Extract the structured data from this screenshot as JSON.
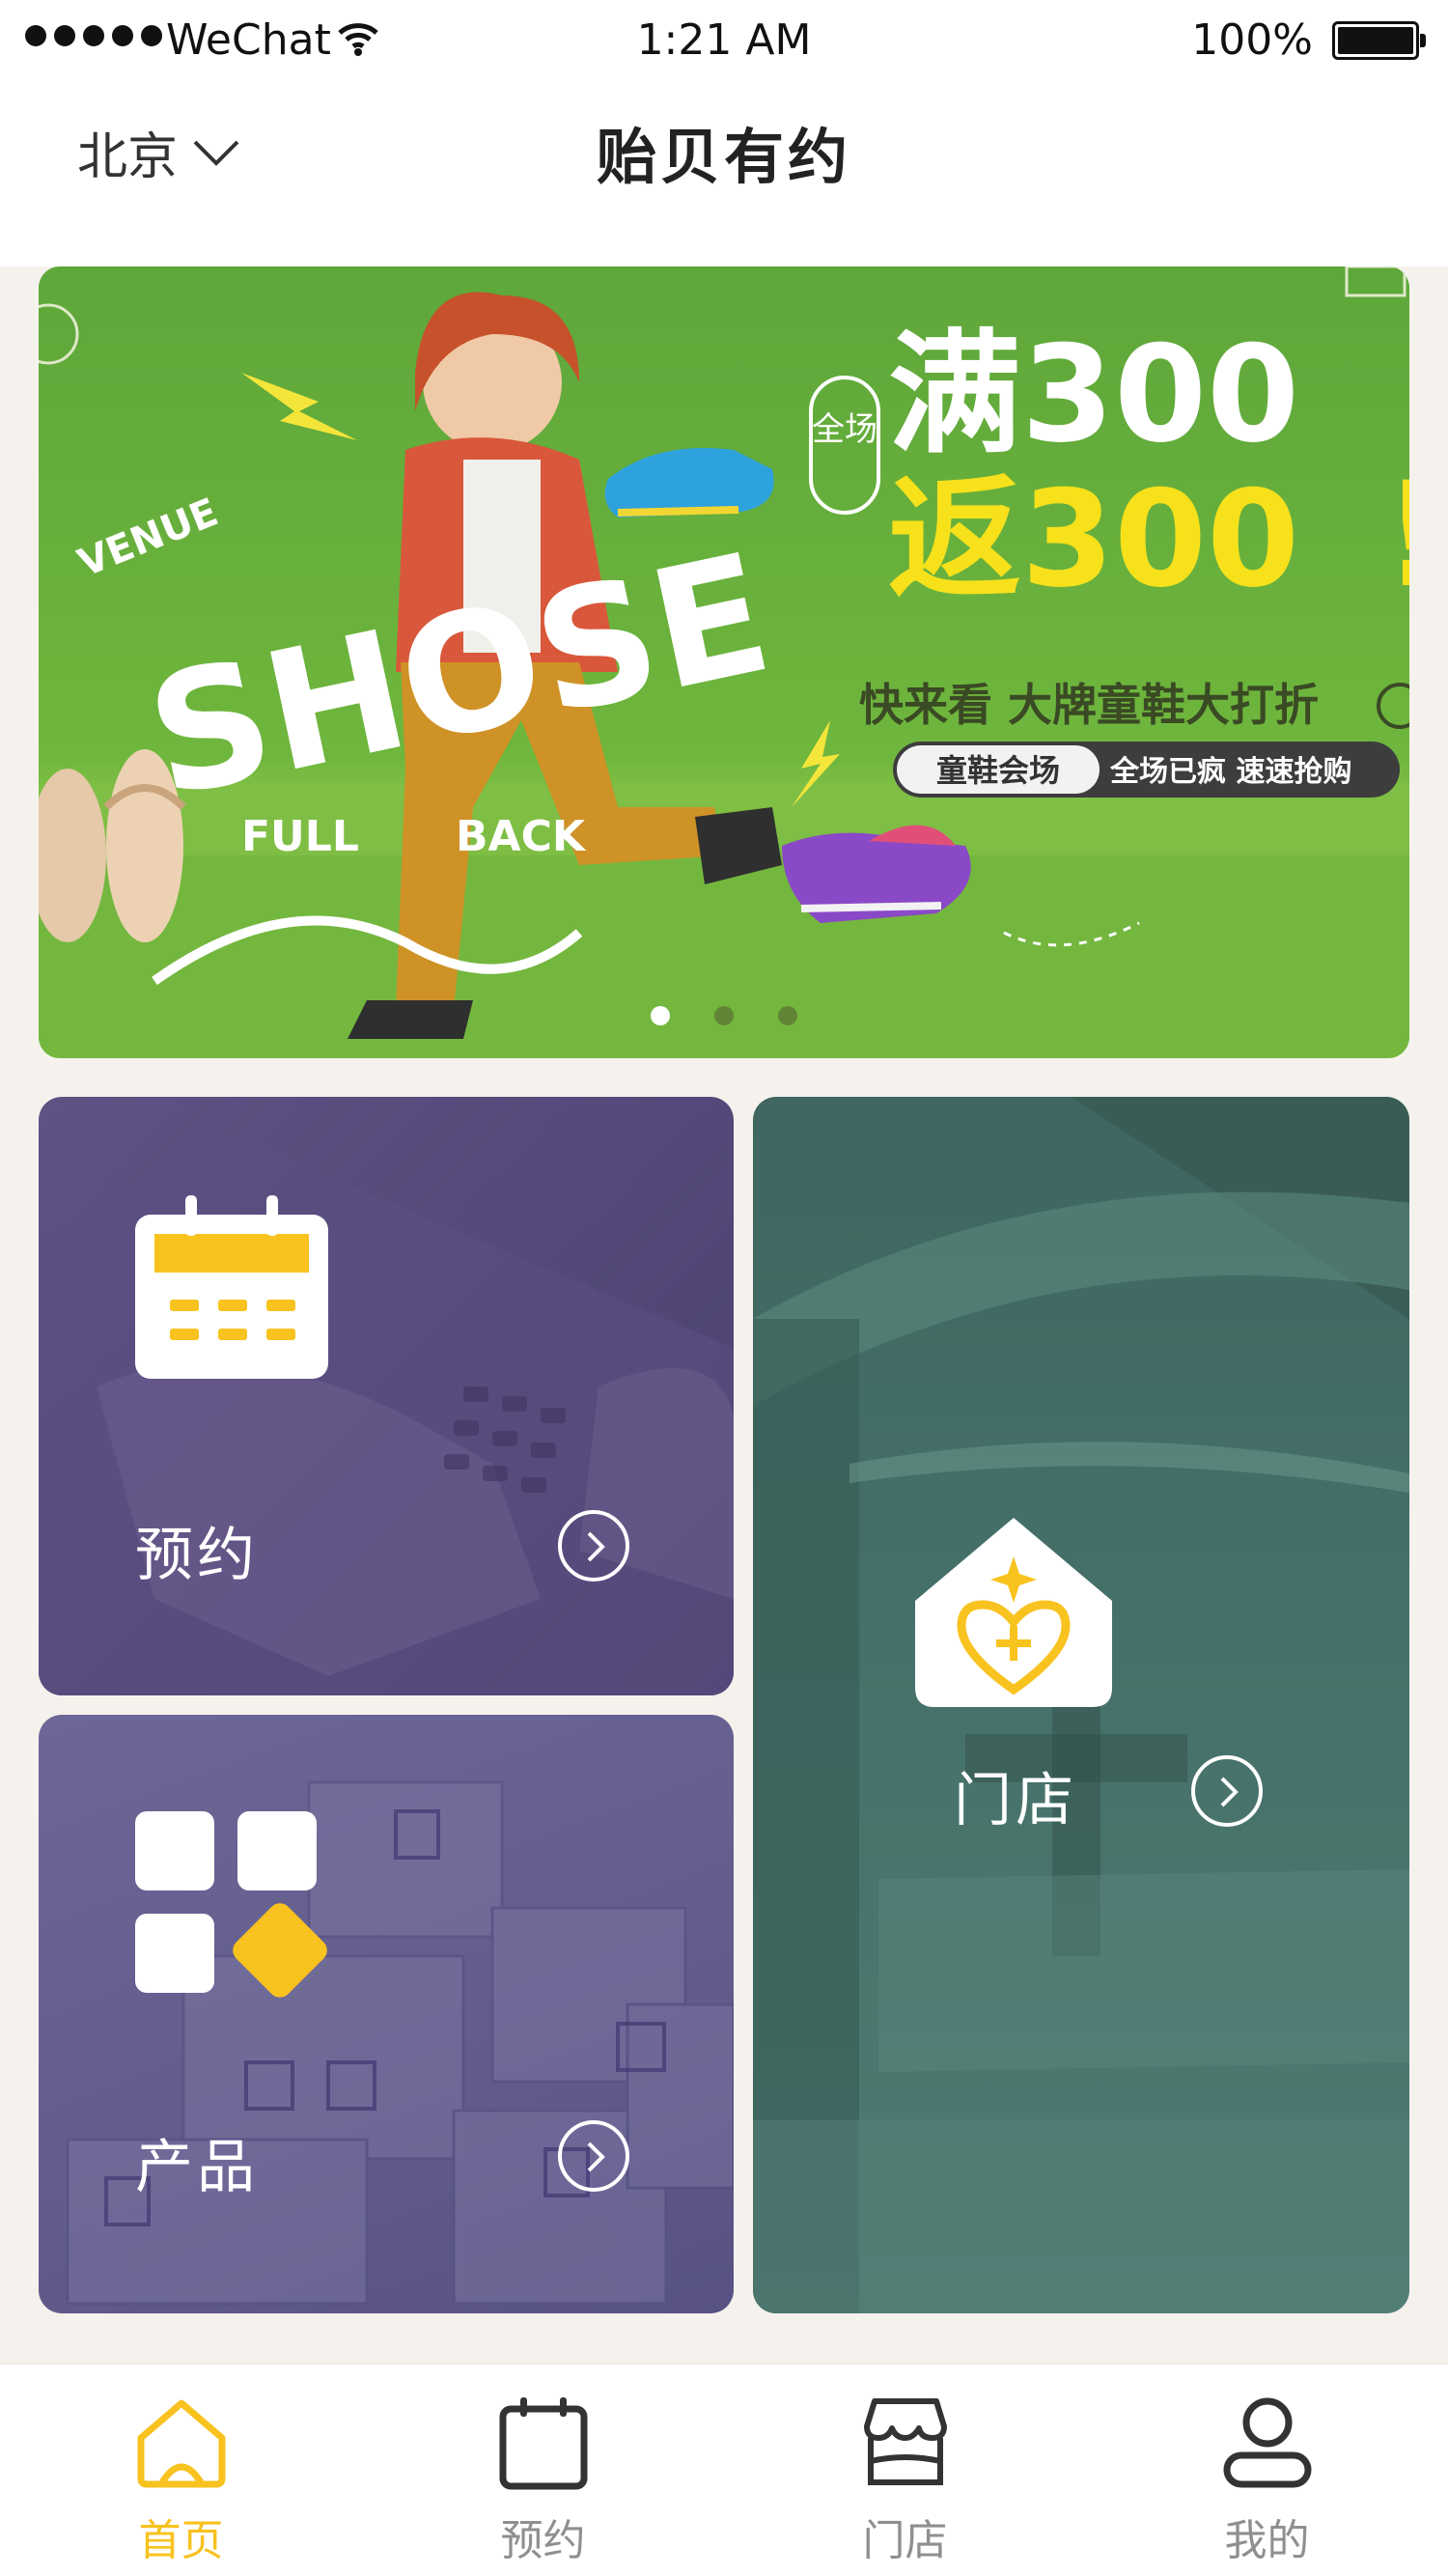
{
  "status_bar": {
    "carrier": "WeChat",
    "time": "1:21 AM",
    "battery": "100%"
  },
  "header": {
    "city": "北京",
    "title": "贻贝有约"
  },
  "banner": {
    "badge": "全场",
    "headline_line1": "满300",
    "headline_line2": "返300",
    "subtitle": "快来看 大牌童鞋大打折",
    "pill_label": "童鞋会场",
    "pill_text": "全场已疯 速速抢购",
    "graffiti_word": "SHOSE",
    "graffiti_top": "VENUE",
    "graffiti_left": "FULL",
    "graffiti_right": "BACK",
    "page_count": 3,
    "active_page": 1
  },
  "tiles": {
    "booking": {
      "label": "预约",
      "icon": "calendar-icon"
    },
    "store": {
      "label": "门店",
      "icon": "house-heart-icon"
    },
    "product": {
      "label": "产品",
      "icon": "grid-icon"
    }
  },
  "tabbar": {
    "items": [
      {
        "label": "首页",
        "icon": "home-icon",
        "active": true
      },
      {
        "label": "预约",
        "icon": "calendar-icon",
        "active": false
      },
      {
        "label": "门店",
        "icon": "store-icon",
        "active": false
      },
      {
        "label": "我的",
        "icon": "user-icon",
        "active": false
      }
    ]
  },
  "colors": {
    "accent": "#f8c21f",
    "booking_tile": "#574a7e",
    "store_tile": "#3f6b64",
    "product_tile": "#6a6494",
    "banner_green": "#6bb33a"
  }
}
